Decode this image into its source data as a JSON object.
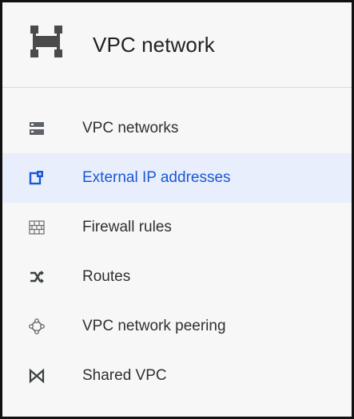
{
  "header": {
    "title": "VPC network",
    "icon": "vpc-network-icon"
  },
  "nav": {
    "items": [
      {
        "label": "VPC networks",
        "icon": "vpc-networks-icon",
        "active": false
      },
      {
        "label": "External IP addresses",
        "icon": "external-ip-icon",
        "active": true
      },
      {
        "label": "Firewall rules",
        "icon": "firewall-icon",
        "active": false
      },
      {
        "label": "Routes",
        "icon": "routes-icon",
        "active": false
      },
      {
        "label": "VPC network peering",
        "icon": "peering-icon",
        "active": false
      },
      {
        "label": "Shared VPC",
        "icon": "shared-vpc-icon",
        "active": false
      }
    ]
  },
  "colors": {
    "active_background": "#e8eefc",
    "active_text": "#1a57d6",
    "text": "#2f3033",
    "icon": "#5f6368"
  }
}
